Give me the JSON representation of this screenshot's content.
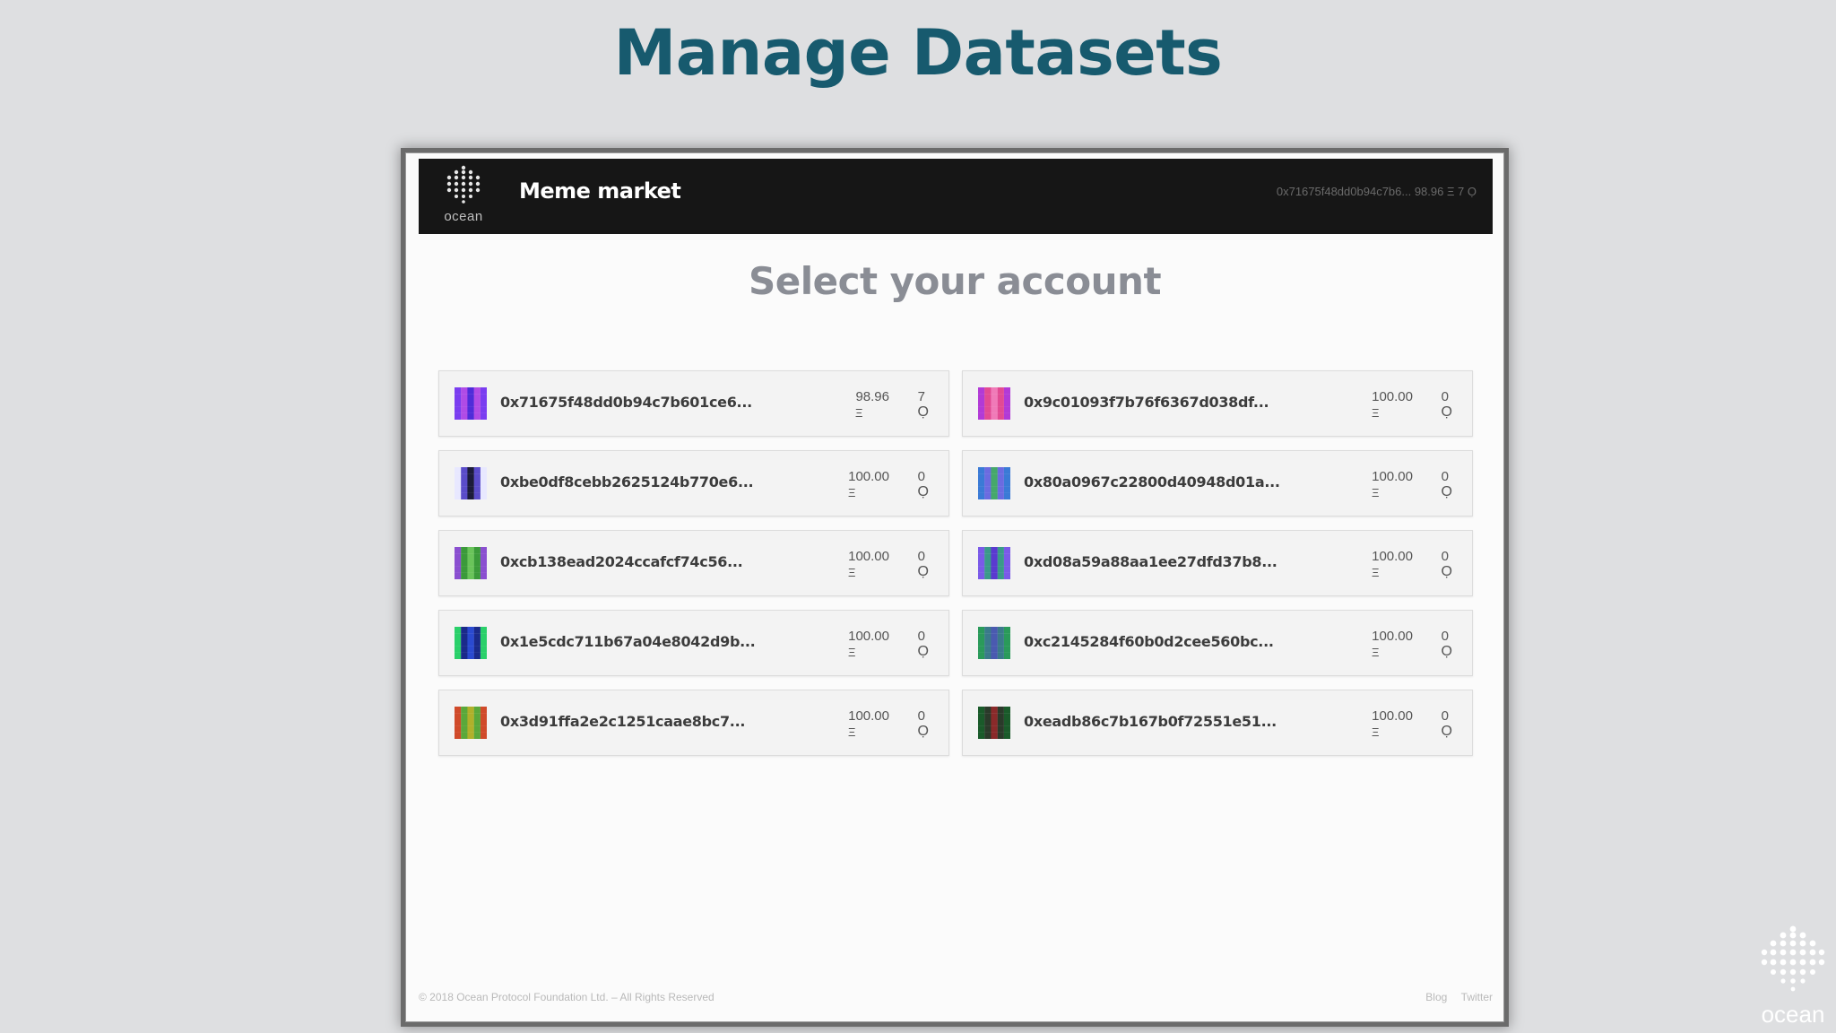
{
  "slide": {
    "title": "Manage Datasets",
    "brand": "ocean"
  },
  "app": {
    "logo_text": "ocean",
    "name": "Meme market",
    "header_account": "0x71675f48dd0b94c7b6...  98.96 Ξ  7 Ọ"
  },
  "page": {
    "heading": "Select your account"
  },
  "accounts": [
    {
      "address": "0x71675f48dd0b94c7b601ce6...",
      "eth": "98.96",
      "eth_symbol": "Ξ",
      "tokens": "7",
      "token_symbol": "Ọ",
      "avatar_colors": [
        "#7a3df0",
        "#4f2cd9",
        "#b04be6"
      ]
    },
    {
      "address": "0x9c01093f7b76f6367d038df...",
      "eth": "100.00",
      "eth_symbol": "Ξ",
      "tokens": "0",
      "token_symbol": "Ọ",
      "avatar_colors": [
        "#e24a93",
        "#b23ad6",
        "#f07ab8"
      ]
    },
    {
      "address": "0xbe0df8cebb2625124b770e6...",
      "eth": "100.00",
      "eth_symbol": "Ξ",
      "tokens": "0",
      "token_symbol": "Ọ",
      "avatar_colors": [
        "#1c1c3a",
        "#5a4cc9",
        "#e8e8ff"
      ]
    },
    {
      "address": "0x80a0967c22800d40948d01a...",
      "eth": "100.00",
      "eth_symbol": "Ξ",
      "tokens": "0",
      "token_symbol": "Ọ",
      "avatar_colors": [
        "#3a7ad6",
        "#45a86a",
        "#6b6be0"
      ]
    },
    {
      "address": "0xcb138ead2024ccafcf74c56...",
      "eth": "100.00",
      "eth_symbol": "Ξ",
      "tokens": "0",
      "token_symbol": "Ọ",
      "avatar_colors": [
        "#3b9a3a",
        "#8a4fd0",
        "#6ac45a"
      ]
    },
    {
      "address": "0xd08a59a88aa1ee27dfd37b8...",
      "eth": "100.00",
      "eth_symbol": "Ξ",
      "tokens": "0",
      "token_symbol": "Ọ",
      "avatar_colors": [
        "#5a3ad0",
        "#3a9a8a",
        "#7a5ae8"
      ]
    },
    {
      "address": "0x1e5cdc711b67a04e8042d9b...",
      "eth": "100.00",
      "eth_symbol": "Ξ",
      "tokens": "0",
      "token_symbol": "Ọ",
      "avatar_colors": [
        "#2ad06a",
        "#2a4ad0",
        "#1a2a8a"
      ]
    },
    {
      "address": "0xc2145284f60b0d2cee560bc...",
      "eth": "100.00",
      "eth_symbol": "Ξ",
      "tokens": "0",
      "token_symbol": "Ọ",
      "avatar_colors": [
        "#3a7a8a",
        "#2a9a5a",
        "#4a5ab0"
      ]
    },
    {
      "address": "0x3d91ffa2e2c1251caae8bc7...",
      "eth": "100.00",
      "eth_symbol": "Ξ",
      "tokens": "0",
      "token_symbol": "Ọ",
      "avatar_colors": [
        "#b0b02a",
        "#5aa83a",
        "#d04a2a"
      ]
    },
    {
      "address": "0xeadb86c7b167b0f72551e51...",
      "eth": "100.00",
      "eth_symbol": "Ξ",
      "tokens": "0",
      "token_symbol": "Ọ",
      "avatar_colors": [
        "#1a5a2a",
        "#8a2a2a",
        "#2a3a2a"
      ]
    }
  ],
  "footer": {
    "copyright": "© 2018 Ocean Protocol Foundation Ltd. – All Rights Reserved",
    "links": [
      "Blog",
      "Twitter"
    ]
  }
}
